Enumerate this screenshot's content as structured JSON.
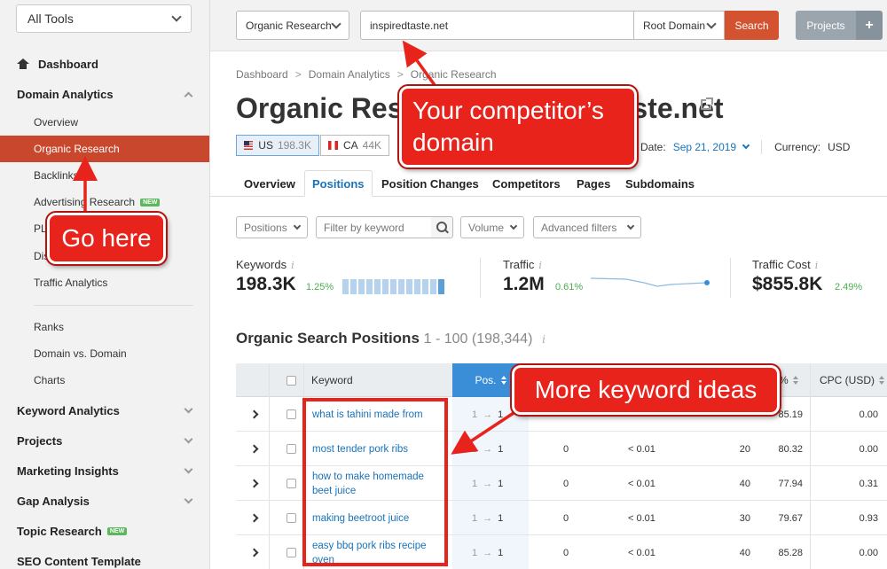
{
  "sidebar": {
    "tools_select": "All Tools",
    "dashboard": "Dashboard",
    "domain_analytics": "Domain Analytics",
    "items": [
      {
        "label": "Overview",
        "new": false
      },
      {
        "label": "Organic Research",
        "new": false
      },
      {
        "label": "Backlinks",
        "new": false
      },
      {
        "label": "Advertising Research",
        "new": true
      },
      {
        "label": "PLA",
        "new": false
      },
      {
        "label": "Display Advertising",
        "new": false
      },
      {
        "label": "Traffic Analytics",
        "new": false
      }
    ],
    "items2": [
      {
        "label": "Ranks"
      },
      {
        "label": "Domain vs. Domain"
      },
      {
        "label": "Charts"
      }
    ],
    "sections": [
      {
        "label": "Keyword Analytics",
        "new": false
      },
      {
        "label": "Projects",
        "new": false
      },
      {
        "label": "Marketing Insights",
        "new": false
      },
      {
        "label": "Gap Analysis",
        "new": false
      },
      {
        "label": "Topic Research",
        "new": true
      },
      {
        "label": "SEO Content Template",
        "new": false
      }
    ],
    "new_badge": "NEW"
  },
  "topbar": {
    "database_select": "Organic Research",
    "search_value": "inspiredtaste.net",
    "scope_select": "Root Domain",
    "search_button": "Search",
    "projects_button": "Projects",
    "plus_button": "+"
  },
  "breadcrumb": [
    "Dashboard",
    "Domain Analytics",
    "Organic Research"
  ],
  "breadcrumb_sep": ">",
  "page_title": "Organic Research: inspiredtaste.net",
  "databases": [
    {
      "code": "US",
      "count": "198.3K"
    },
    {
      "code": "CA",
      "count": "44K"
    }
  ],
  "date": {
    "label": "Date:",
    "value": "Sep 21, 2019",
    "currency_label": "Currency:",
    "currency": "USD"
  },
  "tabs": [
    "Overview",
    "Positions",
    "Position Changes",
    "Competitors",
    "Pages",
    "Subdomains"
  ],
  "filters": {
    "positions": "Positions",
    "keyword_placeholder": "Filter by keyword",
    "volume": "Volume",
    "advanced": "Advanced filters"
  },
  "metrics": [
    {
      "label": "Keywords",
      "value": "198.3K",
      "delta": "1.25%"
    },
    {
      "label": "Traffic",
      "value": "1.2M",
      "delta": "0.61%"
    },
    {
      "label": "Traffic Cost",
      "value": "$855.8K",
      "delta": "2.49%"
    }
  ],
  "info_glyph": "i",
  "section": {
    "title": "Organic Search Positions",
    "range": "1 - 100 (198,344)"
  },
  "table": {
    "headers": {
      "keyword": "Keyword",
      "pos": "Pos.",
      "percent": "%",
      "cpc": "CPC (USD)"
    },
    "rows": [
      {
        "keyword": "what is tahini made from",
        "pos_from": "1",
        "pos_to": "1",
        "traffic": "",
        "traffic_pct": "",
        "volume": "",
        "kd": "85.19",
        "cpc": "0.00"
      },
      {
        "keyword": "most tender pork ribs",
        "pos_from": "1",
        "pos_to": "1",
        "traffic": "0",
        "traffic_pct": "< 0.01",
        "volume": "20",
        "kd": "80.32",
        "cpc": "0.00"
      },
      {
        "keyword": "how to make homemade beet juice",
        "pos_from": "1",
        "pos_to": "1",
        "traffic": "0",
        "traffic_pct": "< 0.01",
        "volume": "40",
        "kd": "77.94",
        "cpc": "0.31"
      },
      {
        "keyword": "making beetroot juice",
        "pos_from": "1",
        "pos_to": "1",
        "traffic": "0",
        "traffic_pct": "< 0.01",
        "volume": "30",
        "kd": "79.67",
        "cpc": "0.93"
      },
      {
        "keyword": "easy bbq pork ribs recipe oven",
        "pos_from": "1",
        "pos_to": "1",
        "traffic": "0",
        "traffic_pct": "< 0.01",
        "volume": "40",
        "kd": "85.28",
        "cpc": "0.00"
      }
    ],
    "arrow": "→"
  },
  "annotations": {
    "competitor": "Your competitor’s domain",
    "go_here": "Go here",
    "more_keywords": "More keyword ideas"
  },
  "colors": {
    "accent": "#d3522f",
    "link": "#1a73b8",
    "callout": "#e8231b"
  }
}
